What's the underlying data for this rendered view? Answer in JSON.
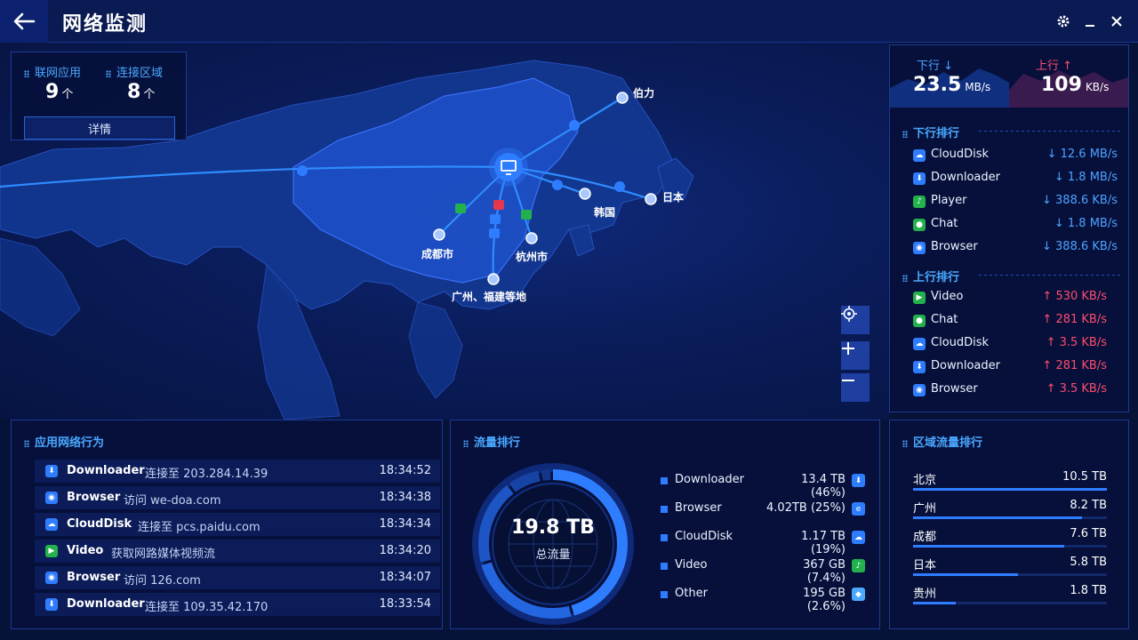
{
  "titlebar": {
    "title": "网络监测"
  },
  "summary": {
    "apps_label": "联网应用",
    "apps_value": "9",
    "apps_unit": "个",
    "regions_label": "连接区域",
    "regions_value": "8",
    "regions_unit": "个",
    "detail_button": "详情"
  },
  "map": {
    "cities": [
      {
        "label": "伯力"
      },
      {
        "label": "日本"
      },
      {
        "label": "韩国"
      },
      {
        "label": "成都市"
      },
      {
        "label": "杭州市"
      },
      {
        "label": "广州、福建等地"
      }
    ]
  },
  "speed": {
    "down_label": "下行",
    "down_value": "23.5",
    "down_unit": "MB/s",
    "up_label": "上行",
    "up_value": "109",
    "up_unit": "KB/s"
  },
  "down_rank": {
    "title": "下行排行",
    "items": [
      {
        "name": "CloudDisk",
        "value": "↓ 12.6 MB/s",
        "icon": "cloud-icon",
        "color": "#2f7dff"
      },
      {
        "name": "Downloader",
        "value": "↓ 1.8 MB/s",
        "icon": "download-icon",
        "color": "#2f7dff"
      },
      {
        "name": "Player",
        "value": "↓ 388.6 KB/s",
        "icon": "music-icon",
        "color": "#22b14c"
      },
      {
        "name": "Chat",
        "value": "↓ 1.8 MB/s",
        "icon": "chat-icon",
        "color": "#22b14c"
      },
      {
        "name": "Browser",
        "value": "↓ 388.6 KB/s",
        "icon": "globe-icon",
        "color": "#2f7dff"
      }
    ]
  },
  "up_rank": {
    "title": "上行排行",
    "items": [
      {
        "name": "Video",
        "value": "↑ 530 KB/s",
        "icon": "video-icon",
        "color": "#22b14c"
      },
      {
        "name": "Chat",
        "value": "↑ 281 KB/s",
        "icon": "chat-icon",
        "color": "#22b14c"
      },
      {
        "name": "CloudDisk",
        "value": "↑ 3.5 KB/s",
        "icon": "cloud-icon",
        "color": "#2f7dff"
      },
      {
        "name": "Downloader",
        "value": "↑ 281 KB/s",
        "icon": "download-icon",
        "color": "#2f7dff"
      },
      {
        "name": "Browser",
        "value": "↑ 3.5 KB/s",
        "icon": "globe-icon",
        "color": "#2f7dff"
      }
    ]
  },
  "activity": {
    "title": "应用网络行为",
    "rows": [
      {
        "app": "Downloader",
        "desc": "连接至 203.284.14.39",
        "time": "18:34:52",
        "icon": "download-icon",
        "color": "#2f7dff"
      },
      {
        "app": "Browser",
        "desc": "访问 we-doa.com",
        "time": "18:34:38",
        "icon": "globe-icon",
        "color": "#2f7dff"
      },
      {
        "app": "CloudDisk",
        "desc": "连接至 pcs.paidu.com",
        "time": "18:34:34",
        "icon": "cloud-icon",
        "color": "#2f7dff"
      },
      {
        "app": "Video",
        "desc": "获取网路媒体视频流",
        "time": "18:34:20",
        "icon": "video-icon",
        "color": "#22b14c"
      },
      {
        "app": "Browser",
        "desc": "访问 126.com",
        "time": "18:34:07",
        "icon": "globe-icon",
        "color": "#2f7dff"
      },
      {
        "app": "Downloader",
        "desc": "连接至 109.35.42.170",
        "time": "18:33:54",
        "icon": "download-icon",
        "color": "#2f7dff"
      }
    ]
  },
  "traffic": {
    "title": "流量排行",
    "total_value": "19.8 TB",
    "total_label": "总流量",
    "items": [
      {
        "name": "Downloader",
        "value": "13.4 TB (46%)",
        "icon": "download-icon",
        "color": "#2f7dff",
        "share": 0.46
      },
      {
        "name": "Browser",
        "value": "4.02TB (25%)",
        "icon": "edge-icon",
        "color": "#2f7dff",
        "share": 0.25
      },
      {
        "name": "CloudDisk",
        "value": "1.17 TB (19%)",
        "icon": "cloud-icon",
        "color": "#2f7dff",
        "share": 0.19
      },
      {
        "name": "Video",
        "value": "367 GB (7.4%)",
        "icon": "music-icon",
        "color": "#22b14c",
        "share": 0.074
      },
      {
        "name": "Other",
        "value": "195 GB (2.6%)",
        "icon": "app-icon",
        "color": "#4aa8ff",
        "share": 0.026
      }
    ]
  },
  "regions": {
    "title": "区域流量排行",
    "items": [
      {
        "name": "北京",
        "value": "10.5 TB",
        "fraction": 1.0
      },
      {
        "name": "广州",
        "value": "8.2 TB",
        "fraction": 0.87
      },
      {
        "name": "成都",
        "value": "7.6 TB",
        "fraction": 0.78
      },
      {
        "name": "日本",
        "value": "5.8 TB",
        "fraction": 0.54
      },
      {
        "name": "贵州",
        "value": "1.8 TB",
        "fraction": 0.22
      }
    ]
  },
  "colors": {
    "accent": "#2f7dff",
    "down": "#4ea3ff",
    "up": "#ff4d6d",
    "panel": "#06103c"
  }
}
